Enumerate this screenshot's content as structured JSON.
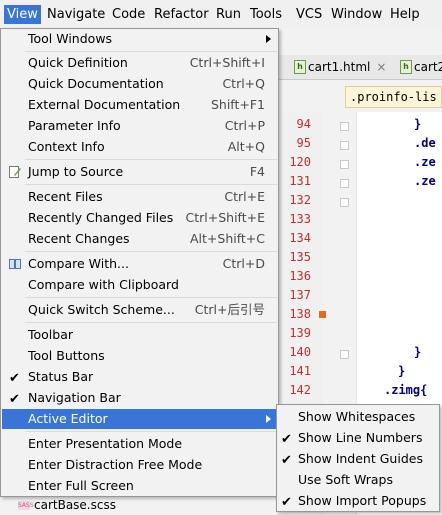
{
  "menubar": {
    "items": [
      "View",
      "Navigate",
      "Code",
      "Refactor",
      "Run",
      "Tools",
      "VCS",
      "Window",
      "Help"
    ]
  },
  "tabs": [
    {
      "label": "cart1.html",
      "close": "×"
    },
    {
      "label": "cart2",
      "close": ""
    }
  ],
  "editor": {
    "breadcrumb": ".proinfo-lis",
    "line_numbers": [
      "94",
      "95",
      "120",
      "131",
      "132",
      "133",
      "134",
      "135",
      "136",
      "137",
      "138",
      "139",
      "140",
      "141",
      "142"
    ],
    "code_lines": [
      "}",
      ".de",
      ".ze",
      ".ze",
      "}",
      "}",
      ".zimg{"
    ]
  },
  "project_file": "cartBase.scss",
  "view_menu": {
    "tool_windows": "Tool Windows",
    "quick_definition": "Quick Definition",
    "quick_definition_sc": "Ctrl+Shift+I",
    "quick_documentation": "Quick Documentation",
    "quick_documentation_sc": "Ctrl+Q",
    "external_documentation": "External Documentation",
    "external_documentation_sc": "Shift+F1",
    "parameter_info": "Parameter Info",
    "parameter_info_sc": "Ctrl+P",
    "context_info": "Context Info",
    "context_info_sc": "Alt+Q",
    "jump_to_source": "Jump to Source",
    "jump_to_source_sc": "F4",
    "recent_files": "Recent Files",
    "recent_files_sc": "Ctrl+E",
    "recently_changed_files": "Recently Changed Files",
    "recently_changed_files_sc": "Ctrl+Shift+E",
    "recent_changes": "Recent Changes",
    "recent_changes_sc": "Alt+Shift+C",
    "compare_with": "Compare With...",
    "compare_with_sc": "Ctrl+D",
    "compare_clipboard": "Compare with Clipboard",
    "quick_switch_scheme": "Quick Switch Scheme...",
    "quick_switch_scheme_sc": "Ctrl+后引号",
    "toolbar": "Toolbar",
    "tool_buttons": "Tool Buttons",
    "status_bar": "Status Bar",
    "navigation_bar": "Navigation Bar",
    "active_editor": "Active Editor",
    "presentation_mode": "Enter Presentation Mode",
    "distraction_free_mode": "Enter Distraction Free Mode",
    "full_screen": "Enter Full Screen"
  },
  "active_editor_submenu": {
    "show_whitespaces": "Show Whitespaces",
    "show_line_numbers": "Show Line Numbers",
    "show_indent_guides": "Show Indent Guides",
    "use_soft_wraps": "Use Soft Wraps",
    "show_import_popups": "Show Import Popups"
  },
  "colors": {
    "selection": "#3875d7",
    "line_number": "#c02f2f",
    "css_selector": "#000080",
    "breakpoint": "#e36b1c"
  }
}
